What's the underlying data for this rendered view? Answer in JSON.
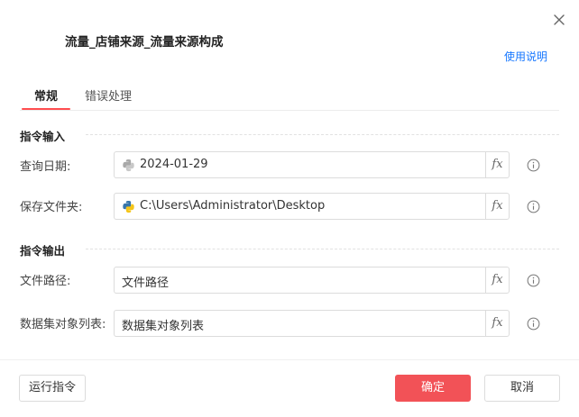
{
  "dialog": {
    "title": "流量_店铺来源_流量来源构成",
    "help_link": "使用说明"
  },
  "tabs": [
    {
      "label": "常规",
      "active": true
    },
    {
      "label": "错误处理",
      "active": false
    }
  ],
  "input_section": {
    "title": "指令输入",
    "fields": [
      {
        "label": "查询日期:",
        "value": "2024-01-29",
        "icon": "python-icon",
        "icon_state": "disabled"
      },
      {
        "label": "保存文件夹:",
        "value": "C:\\Users\\Administrator\\Desktop",
        "icon": "python-icon",
        "icon_state": "enabled"
      }
    ]
  },
  "output_section": {
    "title": "指令输出",
    "fields": [
      {
        "label": "文件路径:",
        "value": "文件路径"
      },
      {
        "label": "数据集对象列表:",
        "value": "数据集对象列表"
      }
    ]
  },
  "fx_label": "fx",
  "footer": {
    "run_label": "运行指令",
    "ok_label": "确定",
    "cancel_label": "取消"
  },
  "colors": {
    "accent": "#f25257",
    "link": "#1677ff",
    "tab_underline": "#ff4d4f"
  }
}
